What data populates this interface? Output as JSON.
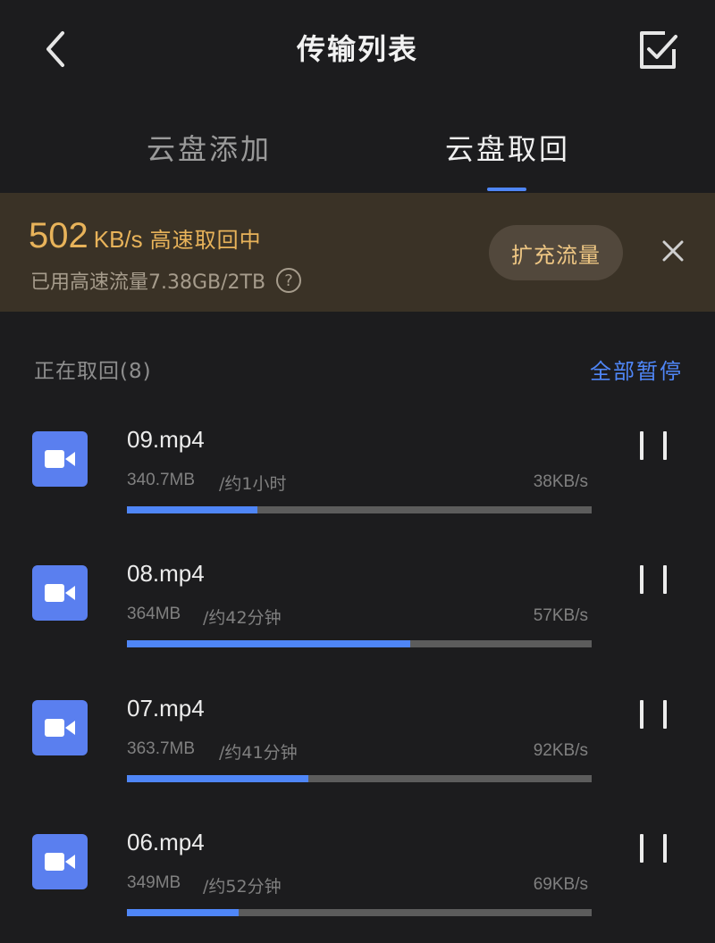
{
  "header": {
    "title": "传输列表",
    "back_icon": "chevron-left-icon",
    "select_icon": "checkbox-icon"
  },
  "tabs": [
    {
      "label": "云盘添加",
      "active": false
    },
    {
      "label": "云盘取回",
      "active": true
    }
  ],
  "banner": {
    "speed_value": "502",
    "speed_unit": "KB/s",
    "speed_status": "高速取回中",
    "quota_text": "已用高速流量7.38GB/2TB",
    "help_glyph": "?",
    "expand_label": "扩充流量",
    "accent_color": "#e8b35a"
  },
  "section": {
    "title": "正在取回(8)",
    "pause_all_label": "全部暂停"
  },
  "transfers": [
    {
      "name": "09.mp4",
      "size": "340.7MB",
      "eta": "/约1小时",
      "speed": "38KB/s",
      "progress": 0.28
    },
    {
      "name": "08.mp4",
      "size": "364MB",
      "eta": "/约42分钟",
      "speed": "57KB/s",
      "progress": 0.61
    },
    {
      "name": "07.mp4",
      "size": "363.7MB",
      "eta": "/约41分钟",
      "speed": "92KB/s",
      "progress": 0.39
    },
    {
      "name": "06.mp4",
      "size": "349MB",
      "eta": "/约52分钟",
      "speed": "69KB/s",
      "progress": 0.24
    }
  ],
  "colors": {
    "background": "#1c1c1e",
    "accent_blue": "#4f86f7",
    "file_icon_bg": "#5a7fef",
    "banner_bg": "#3a3226"
  }
}
